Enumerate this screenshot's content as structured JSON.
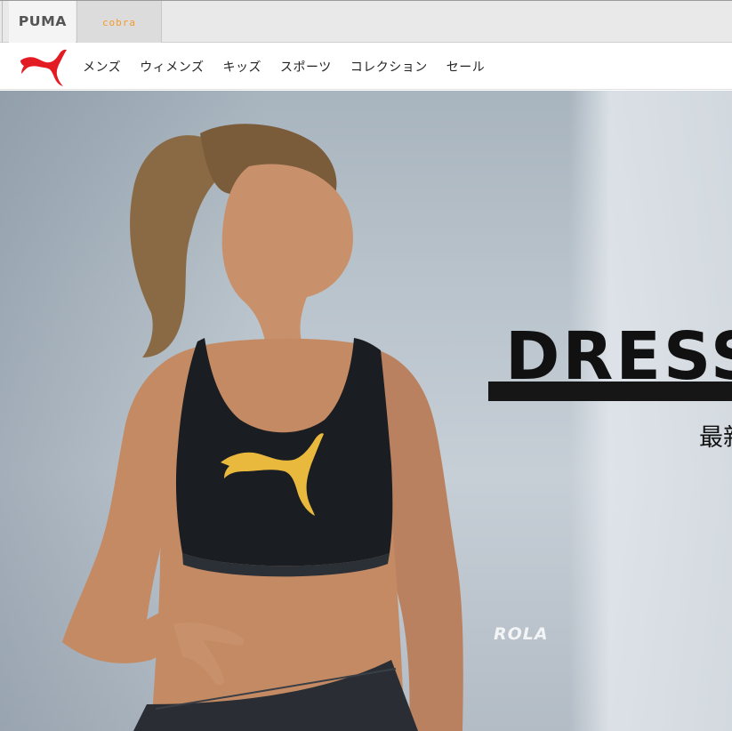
{
  "brand_tabs": [
    {
      "label": "PUMA"
    },
    {
      "label": "cobra"
    }
  ],
  "nav": {
    "items": [
      {
        "label": "メンズ"
      },
      {
        "label": "ウィメンズ"
      },
      {
        "label": "キッズ"
      },
      {
        "label": "スポーツ"
      },
      {
        "label": "コレクション"
      },
      {
        "label": "セール"
      }
    ]
  },
  "hero": {
    "title": "DRESS",
    "subtitle": "最新",
    "model_name": "ROLA"
  },
  "colors": {
    "puma_red": "#e31b23",
    "cobra_orange": "#f29a2e",
    "gold_logo": "#e9b93e"
  },
  "icons": {
    "logo": "puma-cat-logo"
  }
}
